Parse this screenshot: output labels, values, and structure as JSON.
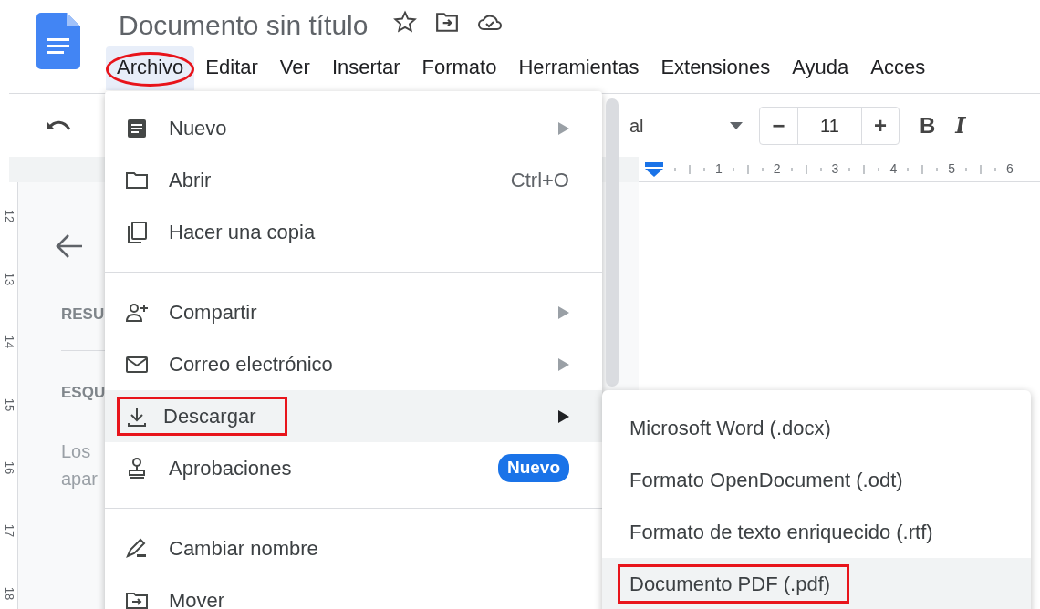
{
  "title": "Documento sin título",
  "menu_bar": [
    {
      "label": "Archivo",
      "selected": true,
      "circled": true
    },
    {
      "label": "Editar",
      "selected": false,
      "circled": false
    },
    {
      "label": "Ver",
      "selected": false,
      "circled": false
    },
    {
      "label": "Insertar",
      "selected": false,
      "circled": false
    },
    {
      "label": "Formato",
      "selected": false,
      "circled": false
    },
    {
      "label": "Herramientas",
      "selected": false,
      "circled": false
    },
    {
      "label": "Extensiones",
      "selected": false,
      "circled": false
    },
    {
      "label": "Ayuda",
      "selected": false,
      "circled": false
    },
    {
      "label": "Acces",
      "selected": false,
      "circled": false
    }
  ],
  "toolbar": {
    "font": "al",
    "font_size": "11",
    "decrease": "−",
    "increase": "+",
    "bold": "B",
    "italic": "I"
  },
  "ruler": {
    "horizontal": [
      "1",
      "2",
      "3",
      "4",
      "5",
      "6"
    ],
    "vertical": [
      "12",
      "13",
      "14",
      "15",
      "16",
      "17",
      "18"
    ]
  },
  "outline": {
    "headings": [
      "RESU",
      "ESQU"
    ],
    "text": [
      "Los",
      "apar"
    ]
  },
  "file_menu": [
    {
      "kind": "item",
      "label": "Nuevo",
      "submenu": true,
      "selected": false,
      "boxed": false
    },
    {
      "kind": "item",
      "label": "Abrir",
      "shortcut": "Ctrl+O",
      "submenu": false,
      "selected": false,
      "boxed": false
    },
    {
      "kind": "item",
      "label": "Hacer una copia",
      "submenu": false,
      "selected": false,
      "boxed": false
    },
    {
      "kind": "separator"
    },
    {
      "kind": "item",
      "label": "Compartir",
      "submenu": true,
      "selected": false,
      "boxed": false
    },
    {
      "kind": "item",
      "label": "Correo electrónico",
      "submenu": true,
      "selected": false,
      "boxed": false
    },
    {
      "kind": "item",
      "label": "Descargar",
      "submenu": true,
      "selected": true,
      "boxed": true
    },
    {
      "kind": "item",
      "label": "Aprobaciones",
      "badge": "Nuevo",
      "submenu": false,
      "selected": false,
      "boxed": false
    },
    {
      "kind": "separator"
    },
    {
      "kind": "item",
      "label": "Cambiar nombre",
      "submenu": false,
      "selected": false,
      "boxed": false
    },
    {
      "kind": "item",
      "label": "Mover",
      "submenu": false,
      "selected": false,
      "boxed": false
    }
  ],
  "download_menu": [
    {
      "label": "Microsoft Word (.docx)",
      "selected": false,
      "boxed": false
    },
    {
      "label": "Formato OpenDocument (.odt)",
      "selected": false,
      "boxed": false
    },
    {
      "label": "Formato de texto enriquecido (.rtf)",
      "selected": false,
      "boxed": false
    },
    {
      "label": "Documento PDF (.pdf)",
      "selected": true,
      "boxed": true
    }
  ]
}
